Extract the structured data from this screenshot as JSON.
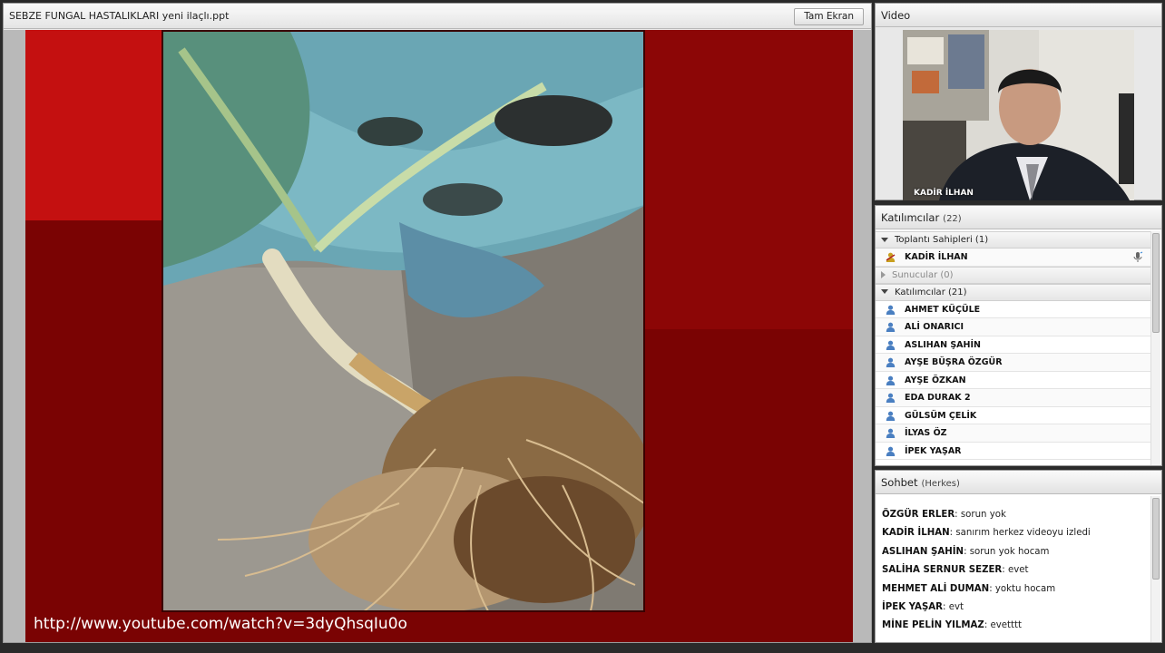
{
  "presentation": {
    "title": "SEBZE FUNGAL HASTALIKLARI yeni ilaçlı.ppt",
    "fullscreen_label": "Tam Ekran",
    "slide_url": "http://www.youtube.com/watch?v=3dyQhsqIu0o"
  },
  "video": {
    "title": "Video",
    "presenter_name": "KADİR  İLHAN"
  },
  "attendees": {
    "title": "Katılımcılar",
    "count": "(22)",
    "groups": [
      {
        "label": "Toplantı Sahipleri (1)",
        "expanded": true
      },
      {
        "label": "Sunucular (0)",
        "expanded": false
      },
      {
        "label": "Katılımcılar (21)",
        "expanded": true
      }
    ],
    "hosts": [
      "KADİR  İLHAN"
    ],
    "participants": [
      "AHMET KÜÇÜLE",
      "ALİ ONARICI",
      "ASLIHAN ŞAHİN",
      "AYŞE BÜŞRA ÖZGÜR",
      "AYŞE ÖZKAN",
      "EDA DURAK 2",
      "GÜLSÜM ÇELİK",
      "İLYAS ÖZ",
      "İPEK YAŞAR"
    ]
  },
  "chat": {
    "title": "Sohbet",
    "scope": "(Herkes)",
    "messages": [
      {
        "sender": "ÖZGÜR ERLER",
        "text": "sorun yok"
      },
      {
        "sender": "KADİR  İLHAN",
        "text": "sanırım herkez videoyu izledi"
      },
      {
        "sender": "ASLIHAN ŞAHİN",
        "text": "sorun yok hocam"
      },
      {
        "sender": "SALİHA SERNUR SEZER",
        "text": "evet"
      },
      {
        "sender": "MEHMET ALİ DUMAN",
        "text": "yoktu  hocam"
      },
      {
        "sender": "İPEK YAŞAR",
        "text": "evt"
      },
      {
        "sender": "MİNE PELİN YILMAZ",
        "text": "evetttt"
      }
    ]
  },
  "colors": {
    "slide_background": "#7a0303",
    "slide_accent": "#c41010"
  }
}
